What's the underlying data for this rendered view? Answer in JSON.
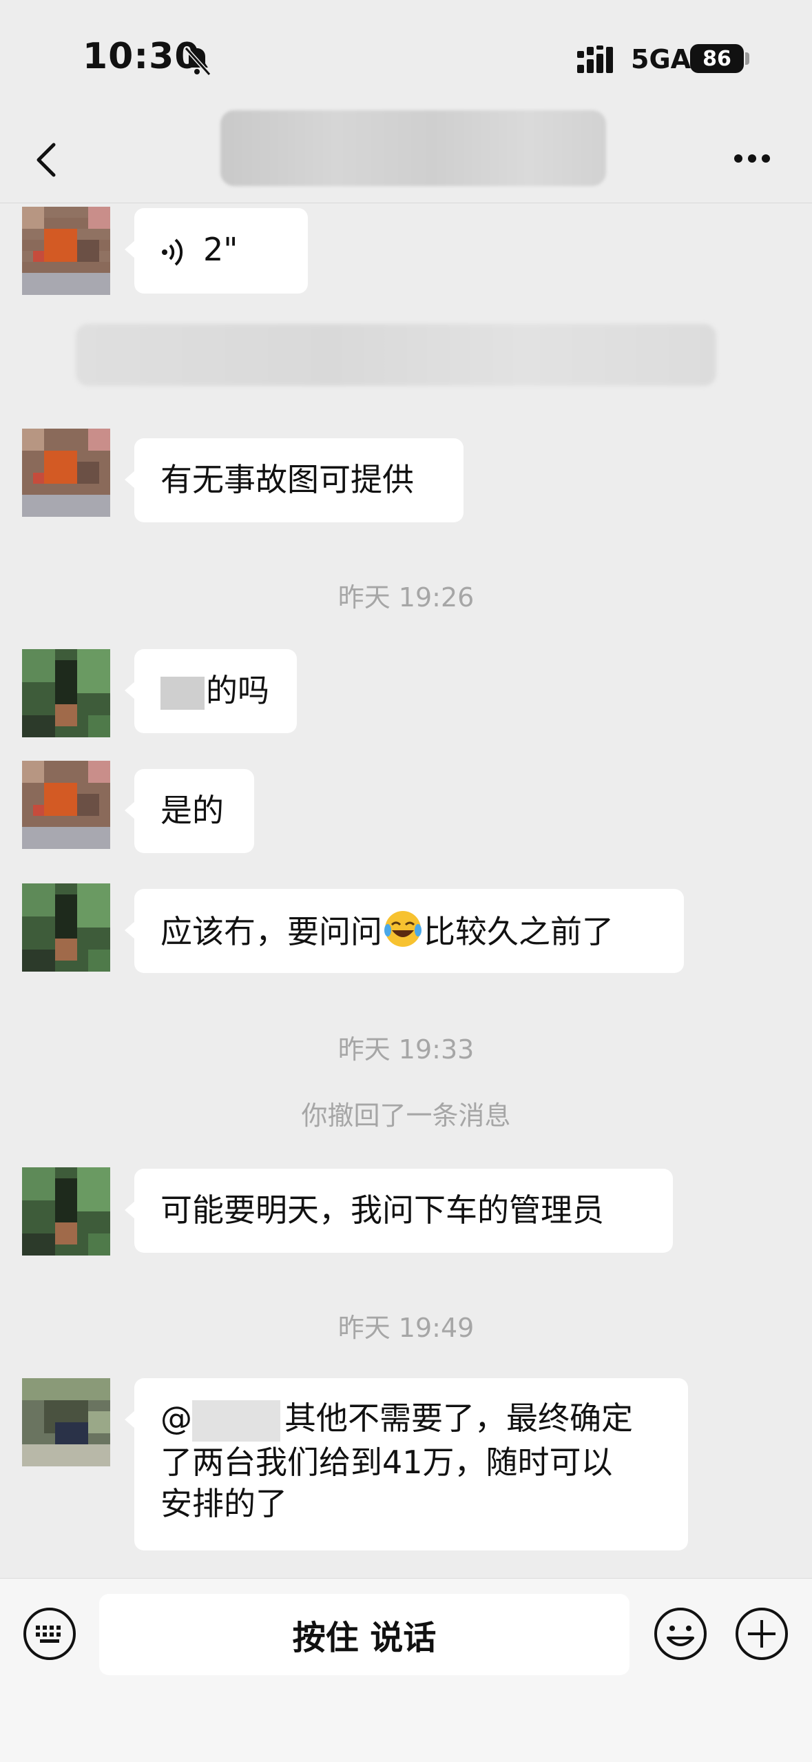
{
  "status": {
    "time": "10:30",
    "network": "5GA",
    "battery": "86"
  },
  "messages": {
    "voice_duration": "2\"",
    "m2": "有无事故图可提供",
    "ts1": "昨天 19:26",
    "m3_suffix": "的吗",
    "m4": "是的",
    "m5_a": "应该冇，要问问",
    "m5_b": "比较久之前了",
    "ts2": "昨天 19:33",
    "recall_notice": "你撤回了一条消息",
    "m6": "可能要明天，我问下车的管理员",
    "ts3": "昨天 19:49",
    "m7_at": "@",
    "m7_a": "其他不需要了，最终确定",
    "m7_b": "了两台我们给到41万，随时可以",
    "m7_c": "安排的了"
  },
  "input": {
    "hold_to_talk": "按住 说话"
  }
}
